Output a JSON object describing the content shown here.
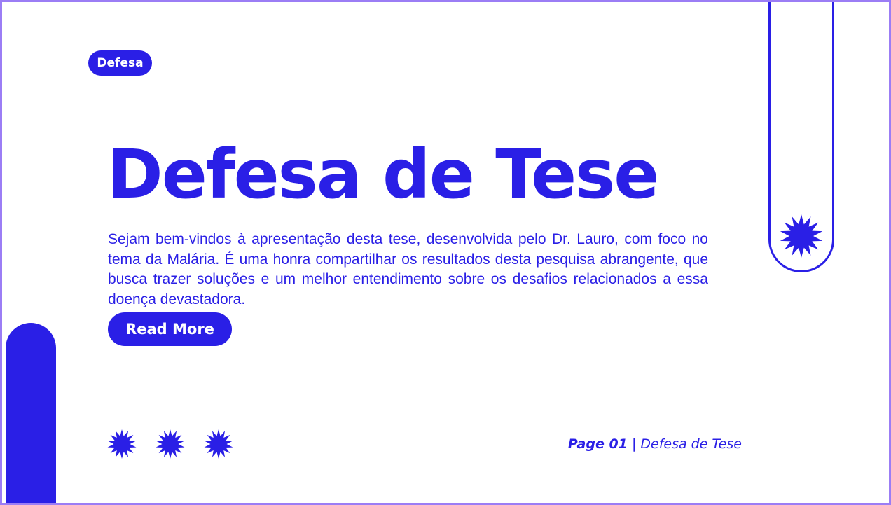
{
  "tag": {
    "label": "Defesa"
  },
  "title": "Defesa de Tese",
  "description": "Sejam bem-vindos à apresentação desta tese, desenvolvida pelo Dr. Lauro, com foco no tema da Malária. É uma honra compartilhar os resultados desta pesquisa abrangente, que busca trazer soluções e um melhor entendimento sobre os desafios relacionados a essa doença devastadora.",
  "cta": {
    "label": "Read More"
  },
  "footer": {
    "page": "Page 01",
    "separator": " | ",
    "label": "Defesa de Tese"
  },
  "colors": {
    "accent": "#2a1fe6",
    "border": "#9b7df5",
    "background": "#ffffff"
  },
  "decorations": {
    "star_icon": "starburst-icon"
  }
}
